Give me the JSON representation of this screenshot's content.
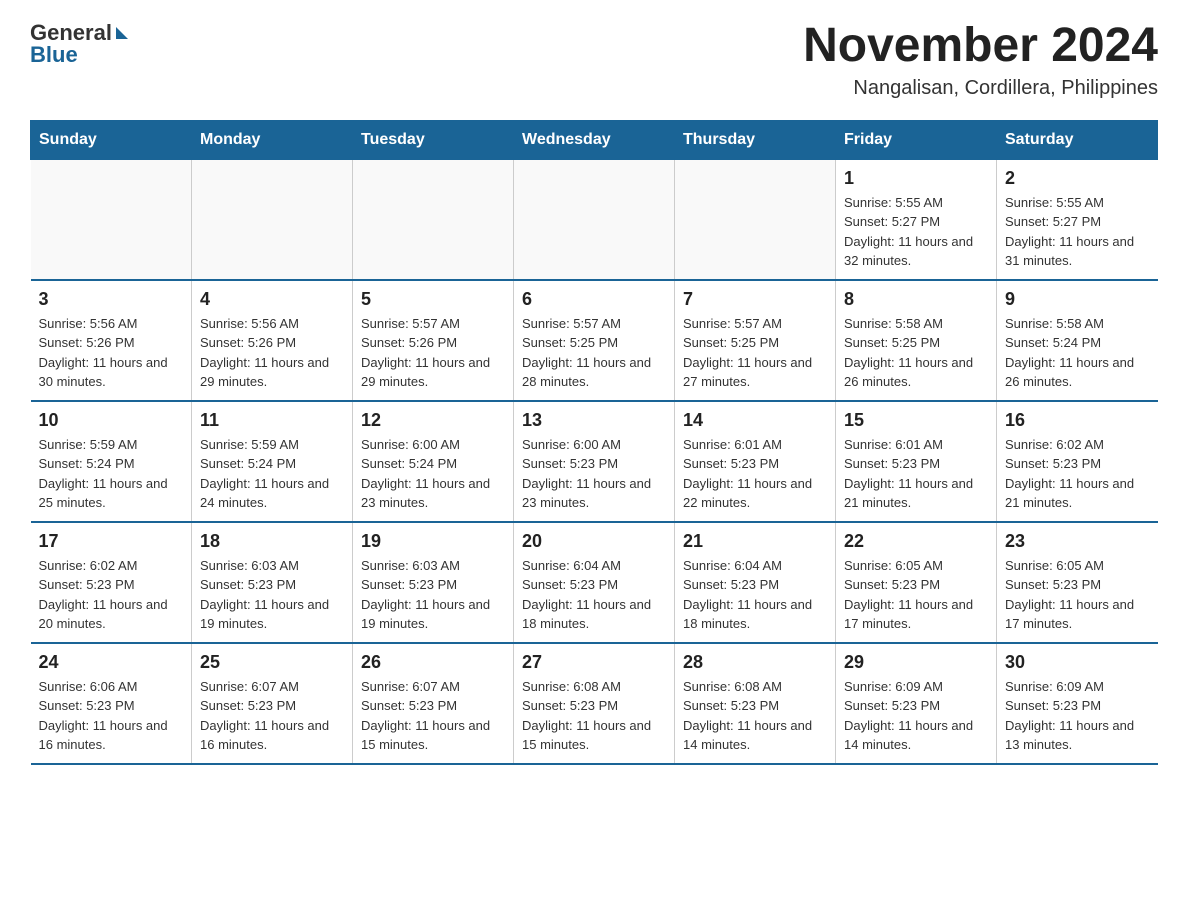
{
  "logo": {
    "general": "General",
    "blue": "Blue"
  },
  "header": {
    "title": "November 2024",
    "subtitle": "Nangalisan, Cordillera, Philippines"
  },
  "weekdays": [
    "Sunday",
    "Monday",
    "Tuesday",
    "Wednesday",
    "Thursday",
    "Friday",
    "Saturday"
  ],
  "weeks": [
    [
      {
        "day": "",
        "info": ""
      },
      {
        "day": "",
        "info": ""
      },
      {
        "day": "",
        "info": ""
      },
      {
        "day": "",
        "info": ""
      },
      {
        "day": "",
        "info": ""
      },
      {
        "day": "1",
        "info": "Sunrise: 5:55 AM\nSunset: 5:27 PM\nDaylight: 11 hours and 32 minutes."
      },
      {
        "day": "2",
        "info": "Sunrise: 5:55 AM\nSunset: 5:27 PM\nDaylight: 11 hours and 31 minutes."
      }
    ],
    [
      {
        "day": "3",
        "info": "Sunrise: 5:56 AM\nSunset: 5:26 PM\nDaylight: 11 hours and 30 minutes."
      },
      {
        "day": "4",
        "info": "Sunrise: 5:56 AM\nSunset: 5:26 PM\nDaylight: 11 hours and 29 minutes."
      },
      {
        "day": "5",
        "info": "Sunrise: 5:57 AM\nSunset: 5:26 PM\nDaylight: 11 hours and 29 minutes."
      },
      {
        "day": "6",
        "info": "Sunrise: 5:57 AM\nSunset: 5:25 PM\nDaylight: 11 hours and 28 minutes."
      },
      {
        "day": "7",
        "info": "Sunrise: 5:57 AM\nSunset: 5:25 PM\nDaylight: 11 hours and 27 minutes."
      },
      {
        "day": "8",
        "info": "Sunrise: 5:58 AM\nSunset: 5:25 PM\nDaylight: 11 hours and 26 minutes."
      },
      {
        "day": "9",
        "info": "Sunrise: 5:58 AM\nSunset: 5:24 PM\nDaylight: 11 hours and 26 minutes."
      }
    ],
    [
      {
        "day": "10",
        "info": "Sunrise: 5:59 AM\nSunset: 5:24 PM\nDaylight: 11 hours and 25 minutes."
      },
      {
        "day": "11",
        "info": "Sunrise: 5:59 AM\nSunset: 5:24 PM\nDaylight: 11 hours and 24 minutes."
      },
      {
        "day": "12",
        "info": "Sunrise: 6:00 AM\nSunset: 5:24 PM\nDaylight: 11 hours and 23 minutes."
      },
      {
        "day": "13",
        "info": "Sunrise: 6:00 AM\nSunset: 5:23 PM\nDaylight: 11 hours and 23 minutes."
      },
      {
        "day": "14",
        "info": "Sunrise: 6:01 AM\nSunset: 5:23 PM\nDaylight: 11 hours and 22 minutes."
      },
      {
        "day": "15",
        "info": "Sunrise: 6:01 AM\nSunset: 5:23 PM\nDaylight: 11 hours and 21 minutes."
      },
      {
        "day": "16",
        "info": "Sunrise: 6:02 AM\nSunset: 5:23 PM\nDaylight: 11 hours and 21 minutes."
      }
    ],
    [
      {
        "day": "17",
        "info": "Sunrise: 6:02 AM\nSunset: 5:23 PM\nDaylight: 11 hours and 20 minutes."
      },
      {
        "day": "18",
        "info": "Sunrise: 6:03 AM\nSunset: 5:23 PM\nDaylight: 11 hours and 19 minutes."
      },
      {
        "day": "19",
        "info": "Sunrise: 6:03 AM\nSunset: 5:23 PM\nDaylight: 11 hours and 19 minutes."
      },
      {
        "day": "20",
        "info": "Sunrise: 6:04 AM\nSunset: 5:23 PM\nDaylight: 11 hours and 18 minutes."
      },
      {
        "day": "21",
        "info": "Sunrise: 6:04 AM\nSunset: 5:23 PM\nDaylight: 11 hours and 18 minutes."
      },
      {
        "day": "22",
        "info": "Sunrise: 6:05 AM\nSunset: 5:23 PM\nDaylight: 11 hours and 17 minutes."
      },
      {
        "day": "23",
        "info": "Sunrise: 6:05 AM\nSunset: 5:23 PM\nDaylight: 11 hours and 17 minutes."
      }
    ],
    [
      {
        "day": "24",
        "info": "Sunrise: 6:06 AM\nSunset: 5:23 PM\nDaylight: 11 hours and 16 minutes."
      },
      {
        "day": "25",
        "info": "Sunrise: 6:07 AM\nSunset: 5:23 PM\nDaylight: 11 hours and 16 minutes."
      },
      {
        "day": "26",
        "info": "Sunrise: 6:07 AM\nSunset: 5:23 PM\nDaylight: 11 hours and 15 minutes."
      },
      {
        "day": "27",
        "info": "Sunrise: 6:08 AM\nSunset: 5:23 PM\nDaylight: 11 hours and 15 minutes."
      },
      {
        "day": "28",
        "info": "Sunrise: 6:08 AM\nSunset: 5:23 PM\nDaylight: 11 hours and 14 minutes."
      },
      {
        "day": "29",
        "info": "Sunrise: 6:09 AM\nSunset: 5:23 PM\nDaylight: 11 hours and 14 minutes."
      },
      {
        "day": "30",
        "info": "Sunrise: 6:09 AM\nSunset: 5:23 PM\nDaylight: 11 hours and 13 minutes."
      }
    ]
  ]
}
